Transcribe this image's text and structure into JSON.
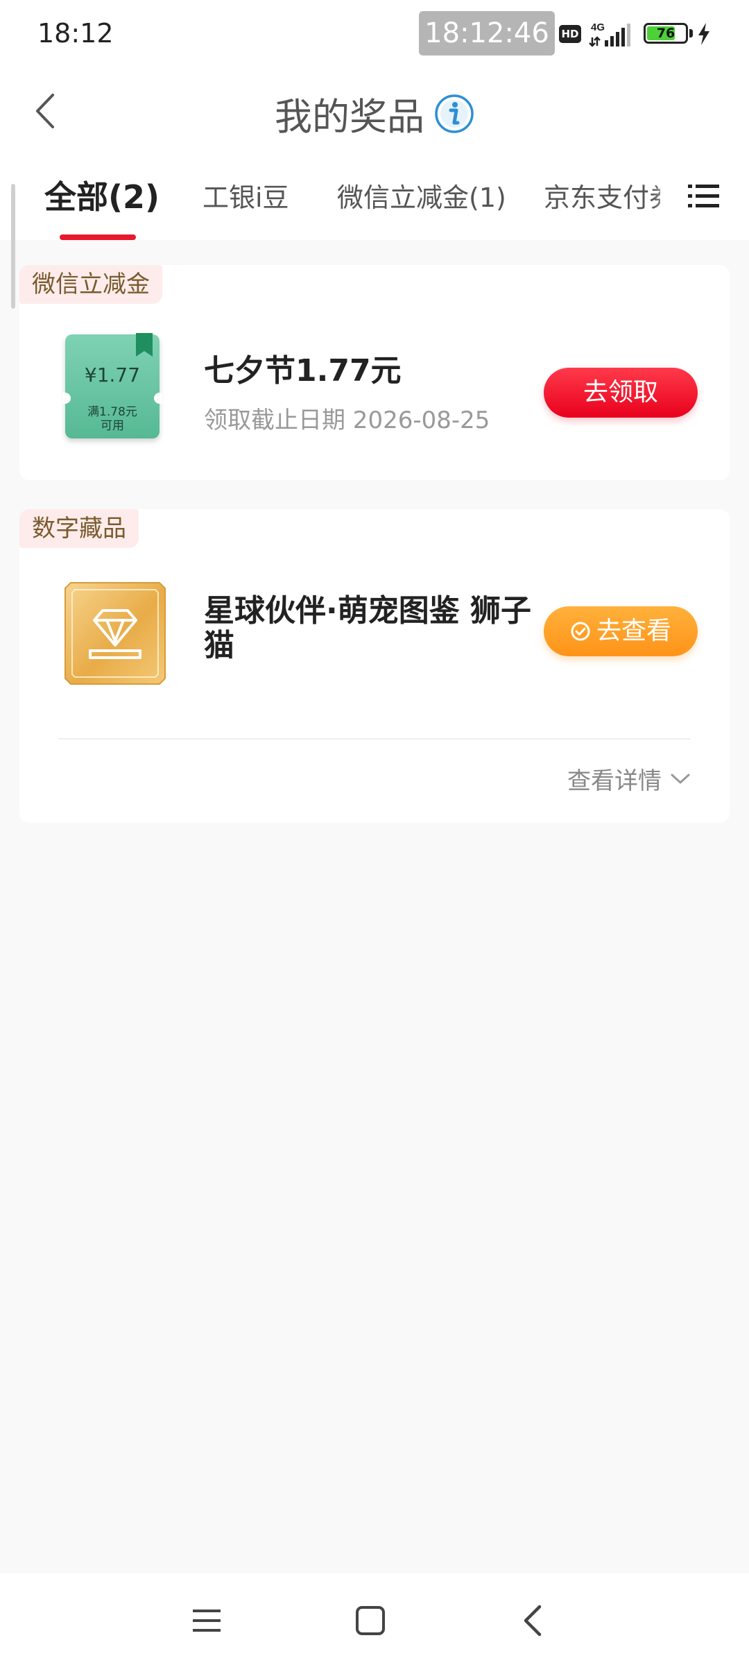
{
  "status_bar": {
    "time": "18:12",
    "overlay_clock": "18:12:46",
    "hd_badge": "HD",
    "network": "4G",
    "battery_percent": "76",
    "battery_level": 0.76
  },
  "header": {
    "title": "我的奖品"
  },
  "tabs": [
    {
      "label": "全部(2)",
      "active": true
    },
    {
      "label": "工银i豆",
      "active": false
    },
    {
      "label": "微信立减金(1)",
      "active": false
    },
    {
      "label": "京东支付券",
      "active": false
    }
  ],
  "cards": [
    {
      "tag": "微信立减金",
      "coupon": {
        "amount": "¥1.77",
        "condition_line1": "满1.78元",
        "condition_line2": "可用"
      },
      "title": "七夕节1.77元",
      "subtitle": "领取截止日期 2026-08-25",
      "button": "去领取"
    },
    {
      "tag": "数字藏品",
      "title": "星球伙伴·萌宠图鉴 狮子猫",
      "button": "去查看",
      "details": "查看详情"
    }
  ],
  "colors": {
    "accent_red": "#e8192c",
    "button_orange": "#ff9318",
    "coupon_green": "#56b994",
    "gold": "#e8ac48"
  }
}
